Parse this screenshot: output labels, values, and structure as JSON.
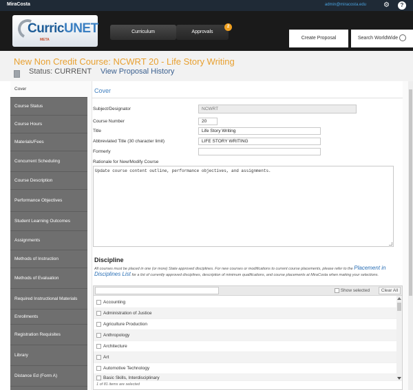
{
  "topbar": {
    "brand": "MiraCosta",
    "user": "admin@miracosta.edu"
  },
  "nav": {
    "logo_a": "Curric",
    "logo_b": "UNET",
    "logo_sub": "META",
    "tabs": [
      "Curriculum",
      "Approvals"
    ],
    "approvals_badge": "2",
    "create_proposal": "Create Proposal",
    "search": "Search WorldWide"
  },
  "header": {
    "title": "New Non Credit Course: NCWRT 20 - Life Story Writing",
    "status": "Status: CURRENT",
    "history": "View Proposal History"
  },
  "sidebar": {
    "items": [
      "Cover",
      "Course Status",
      "Course Hours",
      "Materials/Fees",
      "Concurrent Scheduling",
      "Course Description",
      "Performance Objectives",
      "Student Learning Outcomes",
      "Assignments",
      "Methods of Instruction",
      "Methods of Evaluation",
      "Required Instructional Materials",
      "Enrollments",
      "Registration Requisites",
      "Library",
      "Distance Ed (Form A)"
    ]
  },
  "form": {
    "section_title": "Cover",
    "subject_label": "Subject/Designator",
    "subject_value": "NCWRT",
    "course_number_label": "Course Number",
    "course_number_value": "20",
    "title_label": "Title",
    "title_value": "Life Story Writing",
    "abbr_label": "Abbreviated Title (30 character limit)",
    "abbr_value": "LIFE STORY WRITING",
    "formerly_label": "Formerly",
    "formerly_value": "",
    "rationale_label": "Rationale for New/Modify Course",
    "rationale_value": "Update course content outline, performance objectives, and assignments."
  },
  "discipline": {
    "title": "Discipline",
    "desc_a": "All courses must be placed in one (or more) State approved disciplines. For new courses or modifications to current course placements, please refer to the",
    "link": "Placement in Disciplines List",
    "desc_b": "for a list of currently approved disciplines, description of minimum qualifications, and course placements at MiraCosta when making your selections.",
    "show_selected": "Show selected",
    "clear_all": "Clear All",
    "items": [
      "Accounting",
      "Administration of Justice",
      "Agriculture Production",
      "Anthropology",
      "Architecture",
      "Art",
      "Automotive Technology",
      "Basic Skills, Interdisciplinary"
    ],
    "count": "1 of 81 items are selected"
  }
}
